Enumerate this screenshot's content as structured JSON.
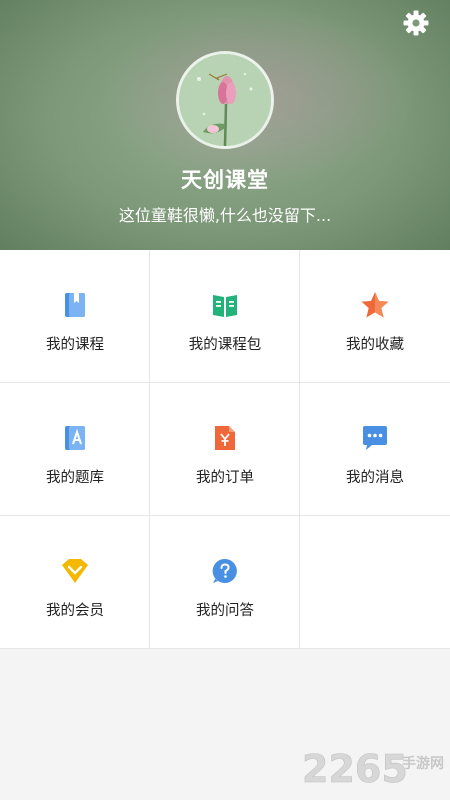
{
  "header": {
    "title": "天创课堂",
    "subtitle": "这位童鞋很懒,什么也没留下..."
  },
  "menu": {
    "items": [
      {
        "label": "我的课程",
        "icon": "book-icon"
      },
      {
        "label": "我的课程包",
        "icon": "open-book-icon"
      },
      {
        "label": "我的收藏",
        "icon": "star-icon"
      },
      {
        "label": "我的题库",
        "icon": "question-bank-icon"
      },
      {
        "label": "我的订单",
        "icon": "order-icon"
      },
      {
        "label": "我的消息",
        "icon": "message-icon"
      },
      {
        "label": "我的会员",
        "icon": "member-icon"
      },
      {
        "label": "我的问答",
        "icon": "qa-icon"
      }
    ]
  },
  "watermark": {
    "number": "2265",
    "text": "手游网"
  },
  "colors": {
    "blue": "#4a90e2",
    "green": "#23b27a",
    "orange": "#f0683a",
    "yellow": "#f5b800"
  }
}
